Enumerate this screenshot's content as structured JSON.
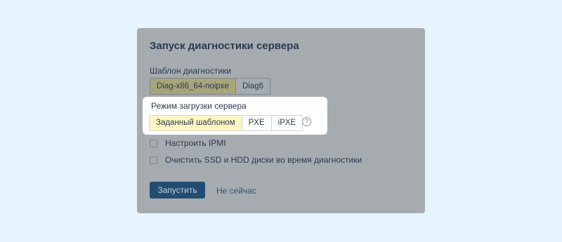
{
  "dialog": {
    "title": "Запуск диагностики сервера",
    "template": {
      "label": "Шаблон диагностики",
      "options": [
        "Diag-x86_64-noipxe",
        "Diag6"
      ],
      "selected": "Diag-x86_64-noipxe"
    },
    "boot_mode": {
      "label": "Режим загрузки сервера",
      "options": [
        "Заданный шаблоном",
        "PXE",
        "iPXE"
      ],
      "selected": "Заданный шаблоном",
      "help_icon": "?"
    },
    "checkboxes": [
      {
        "label": "Настроить IPMI",
        "checked": false
      },
      {
        "label": "Очистить SSD и HDD диски во время диагностики",
        "checked": false
      }
    ],
    "primary_button": "Запустить",
    "secondary_link": "Не сейчас"
  },
  "colors": {
    "background": "#e8f4fd",
    "overlay_dialog": "#a6abb0",
    "primary_button": "#234c73",
    "active_option": "#fff6c2"
  }
}
